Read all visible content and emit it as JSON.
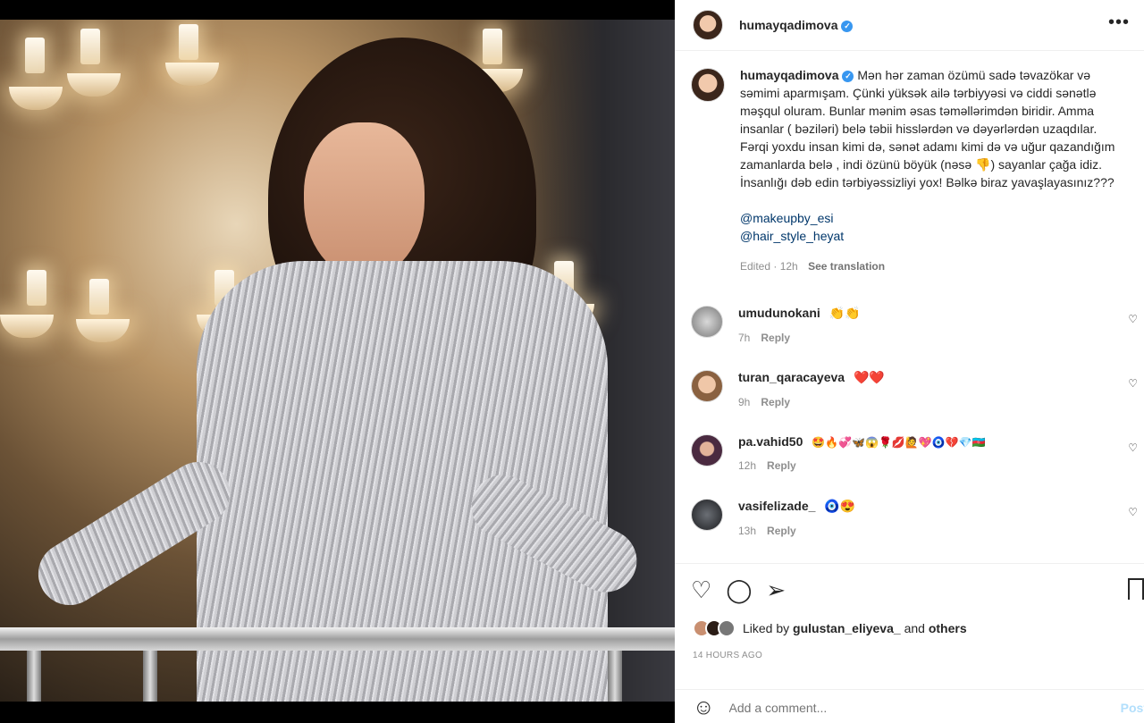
{
  "post": {
    "username": "humayqadimova",
    "verified_icon": "verified-badge-icon",
    "caption": "Mən hər zaman özümü sadə təvazökar və səmimi aparmışam. Çünki yüksək ailə tərbiyyəsi və ciddi sənətlə məşqul oluram. Bunlar mənim əsas təməllərimdən biridir. Amma insanlar ( bəziləri) belə təbii hisslərdən və dəyərlərdən uzaqdılar. Fərqi yoxdu insan kimi də, sənət adamı kimi də və uğur qazandığım zamanlarda belə , indi özünü böyük (nəsə 👎) sayanlar çağa idiz. İnsanlığı dəb edin tərbiyəssizliyi yox! Bəlkə biraz yavaşlayasınız???",
    "mentions": [
      "@makeupby_esi",
      "@hair_style_heyat"
    ],
    "edited": "Edited · 12h",
    "see_translation": "See translation"
  },
  "comments": [
    {
      "user": "umudunokani",
      "text": "👏👏",
      "time": "7h",
      "reply": "Reply"
    },
    {
      "user": "turan_qaracayeva",
      "text": "❤️❤️",
      "time": "9h",
      "reply": "Reply"
    },
    {
      "user": "pa.vahid50",
      "text": "🤩🔥💞🦋😱🌹💋🙋💖🧿💔💎🇦🇿",
      "time": "12h",
      "reply": "Reply"
    },
    {
      "user": "vasifelizade_",
      "text": "🧿😍",
      "time": "13h",
      "reply": "Reply"
    }
  ],
  "likes": {
    "prefix": "Liked by",
    "user": "gulustan_eliyeva_",
    "and": "and",
    "others": "others"
  },
  "time_ago": "14 HOURS AGO",
  "comment_box": {
    "placeholder": "Add a comment...",
    "post_label": "Post"
  },
  "colors": {
    "verified": "#3897f0",
    "link": "#00376b",
    "muted": "#8e8e8e",
    "post_disabled": "#b2dffc"
  }
}
